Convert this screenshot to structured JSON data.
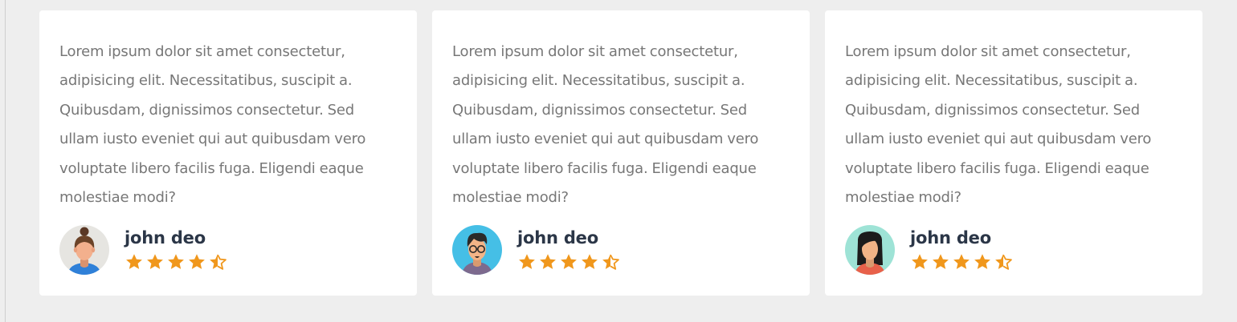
{
  "colors": {
    "page_background": "#eeeeee",
    "card_background": "#ffffff",
    "text": "#777777",
    "name": "#2b3647",
    "star": "#f0971c"
  },
  "testimonials": [
    {
      "text": "Lorem ipsum dolor sit amet consectetur, adipisicing elit. Necessitatibus, suscipit a. Quibusdam, dignissimos consectetur. Sed ullam iusto eveniet qui aut quibusdam vero voluptate libero facilis fuga. Eligendi eaque molestiae modi?",
      "name": "john deo",
      "avatar": "female-avatar-bun-icon",
      "rating": 4.5
    },
    {
      "text": "Lorem ipsum dolor sit amet consectetur, adipisicing elit. Necessitatibus, suscipit a. Quibusdam, dignissimos consectetur. Sed ullam iusto eveniet qui aut quibusdam vero voluptate libero facilis fuga. Eligendi eaque molestiae modi?",
      "name": "john deo",
      "avatar": "male-avatar-glasses-icon",
      "rating": 4.5
    },
    {
      "text": "Lorem ipsum dolor sit amet consectetur, adipisicing elit. Necessitatibus, suscipit a. Quibusdam, dignissimos consectetur. Sed ullam iusto eveniet qui aut quibusdam vero voluptate libero facilis fuga. Eligendi eaque molestiae modi?",
      "name": "john deo",
      "avatar": "female-avatar-long-hair-icon",
      "rating": 4.5
    }
  ]
}
